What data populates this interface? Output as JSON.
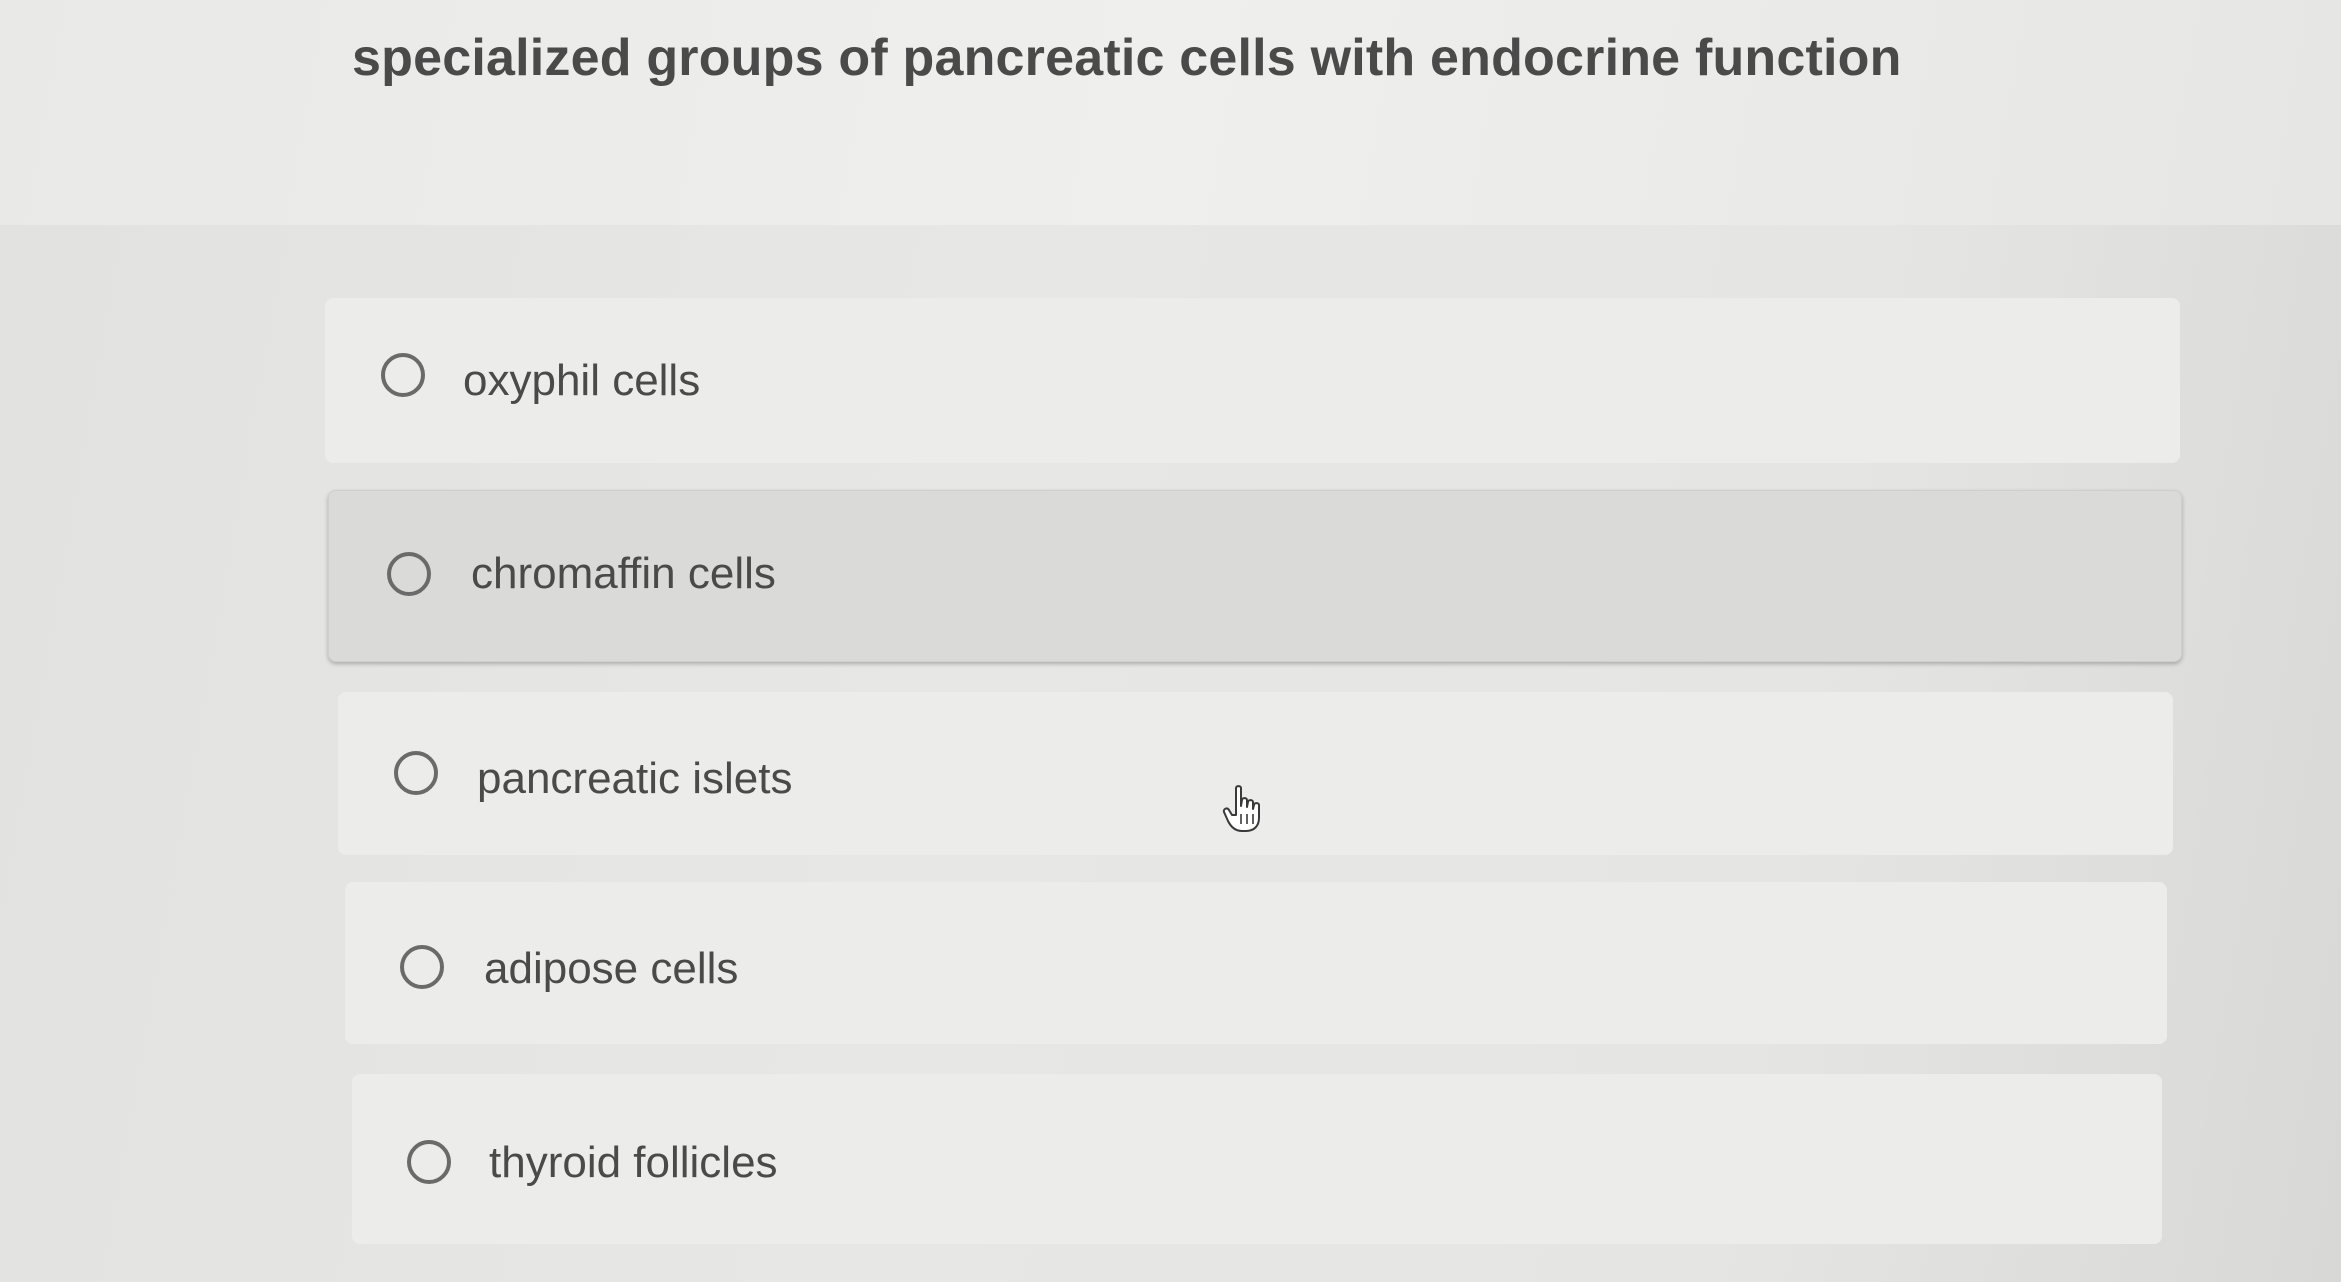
{
  "question": {
    "title": "specialized groups of pancreatic cells with endocrine function"
  },
  "options": [
    {
      "label": "oxyphil cells",
      "selected": false
    },
    {
      "label": "chromaffin cells",
      "selected": false,
      "hovered": true
    },
    {
      "label": "pancreatic islets",
      "selected": false
    },
    {
      "label": "adipose cells",
      "selected": false
    },
    {
      "label": "thyroid follicles",
      "selected": false
    }
  ],
  "cursor": {
    "icon": "hand-pointer-icon"
  },
  "colors": {
    "text": "#4a4a4a",
    "option_bg": "#ececea",
    "option_hover_bg": "#dadad8",
    "radio_border": "#6a6a6a"
  }
}
